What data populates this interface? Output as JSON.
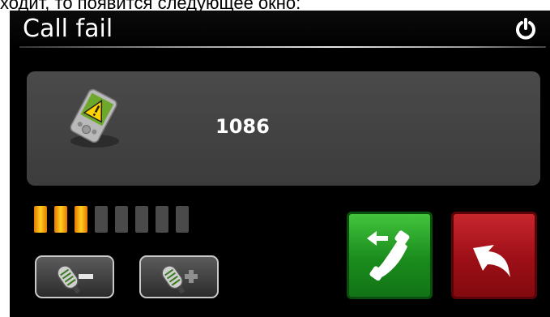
{
  "caption": "ходит, то появится следующее окно:",
  "title": "Call fail",
  "number": "1086",
  "signal": {
    "level": 3,
    "max": 8
  },
  "colors": {
    "call_button": "#2a9c2a",
    "back_button": "#b01a22",
    "signal_on": "#f5a800",
    "panel": "#444444"
  },
  "icons": {
    "power": "power-icon",
    "device": "pda-warning-icon",
    "volume_down": "microphone-minus-icon",
    "volume_up": "microphone-plus-icon",
    "call": "phone-redial-icon",
    "back": "back-arrow-icon"
  }
}
